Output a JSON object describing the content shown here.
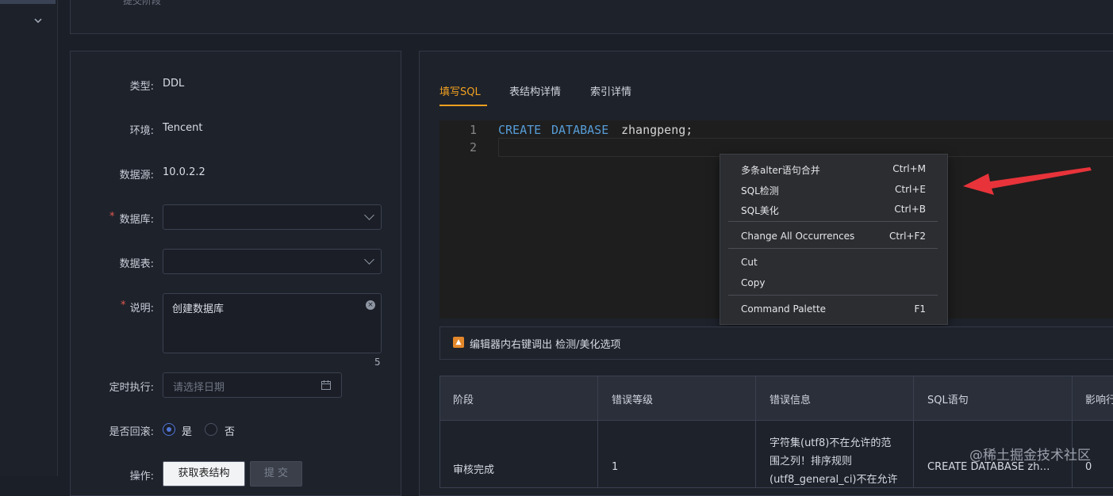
{
  "top_card": {
    "faded_label": "提交阶段"
  },
  "form": {
    "type_label": "类型:",
    "type_value": "DDL",
    "env_label": "环境:",
    "env_value": "Tencent",
    "datasource_label": "数据源:",
    "datasource_value": "10.0.2.2",
    "database_label": "数据库:",
    "table_label": "数据表:",
    "desc_label": "说明:",
    "desc_value": "创建数据库",
    "desc_count": "5",
    "schedule_label": "定时执行:",
    "schedule_placeholder": "请选择日期",
    "rollback_label": "是否回滚:",
    "rollback_yes": "是",
    "rollback_no": "否",
    "action_label": "操作:",
    "fetch_button": "获取表结构",
    "submit_button": "提 交",
    "required_mark": "*"
  },
  "tabs": [
    "填写SQL",
    "表结构详情",
    "索引详情"
  ],
  "editor": {
    "line_numbers": [
      "1",
      "2"
    ],
    "keyword1": "CREATE",
    "keyword2": "DATABASE",
    "identifier": "zhangpeng;"
  },
  "context_menu": {
    "items": [
      {
        "label": "多条alter语句合并",
        "shortcut": "Ctrl+M"
      },
      {
        "label": "SQL检测",
        "shortcut": "Ctrl+E"
      },
      {
        "label": "SQL美化",
        "shortcut": "Ctrl+B"
      },
      {
        "label": "Change All Occurrences",
        "shortcut": "Ctrl+F2"
      },
      {
        "label": "Cut",
        "shortcut": ""
      },
      {
        "label": "Copy",
        "shortcut": ""
      },
      {
        "label": "Command Palette",
        "shortcut": "F1"
      }
    ]
  },
  "tip": {
    "text": "编辑器内右键调出 检测/美化选项"
  },
  "table": {
    "headers": [
      "阶段",
      "错误等级",
      "错误信息",
      "SQL语句",
      "影响行"
    ],
    "row": {
      "stage": "审核完成",
      "level": "1",
      "error_lines": [
        "字符集(utf8)不在允许的范",
        "围之列！排序规则",
        "(utf8_general_ci)不在允许"
      ],
      "sql": "CREATE DATABASE zh…",
      "rows": "0"
    }
  },
  "watermark": "@稀土掘金技术社区",
  "colors": {
    "accent": "#f0a020",
    "required": "#e05a4f",
    "keyword": "#569cd6",
    "arrow": "#e8333a"
  }
}
